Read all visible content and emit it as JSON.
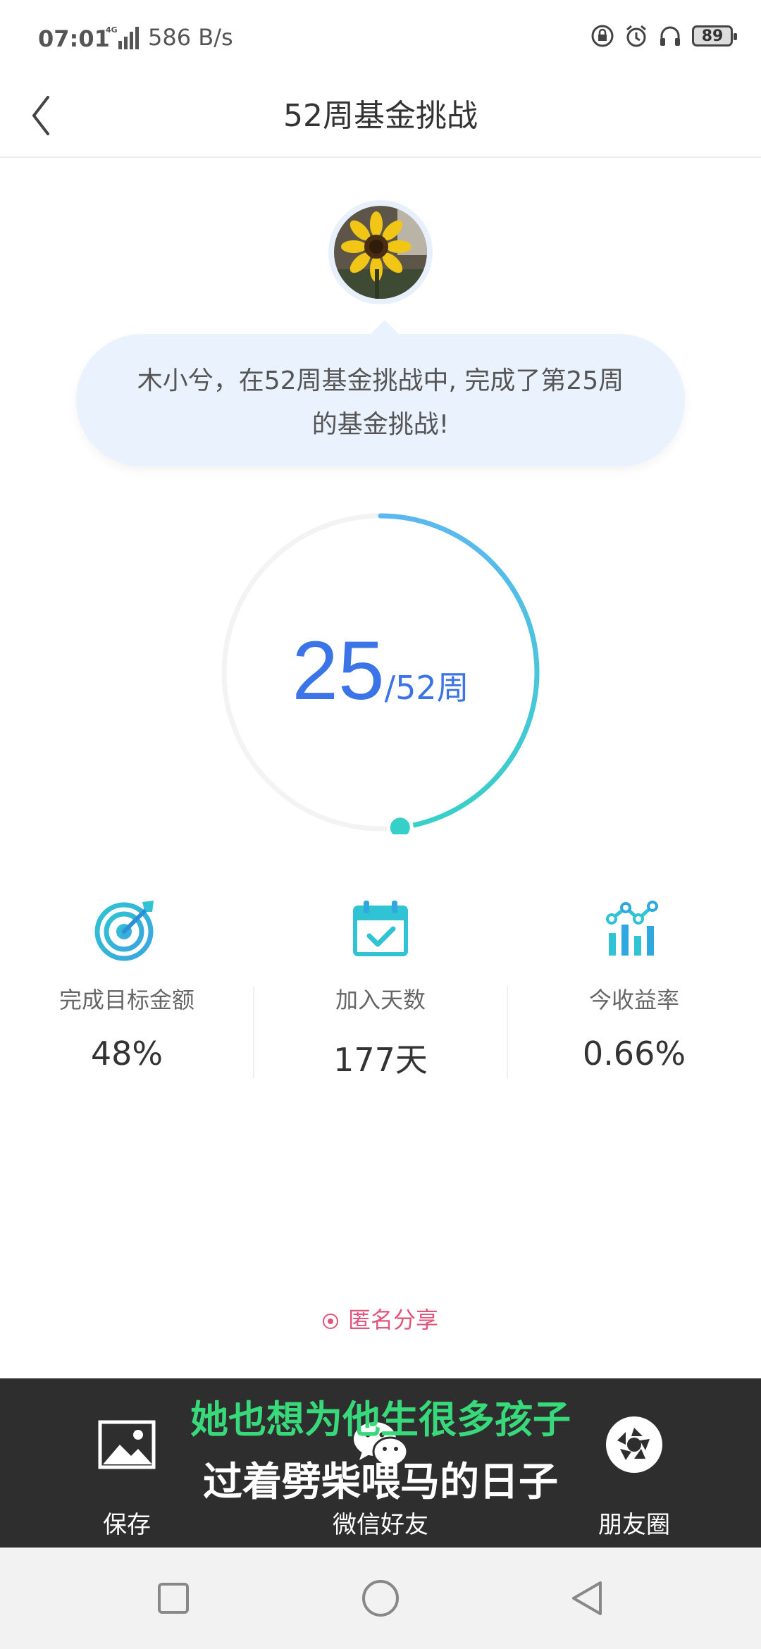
{
  "status_bar": {
    "time": "07:01",
    "network": "4G",
    "speed": "586 B/s",
    "battery": "89",
    "icons": [
      "lock-rotation-icon",
      "alarm-icon",
      "headphones-icon",
      "battery-icon"
    ]
  },
  "header": {
    "title": "52周基金挑战",
    "back_icon": "chevron-left-icon"
  },
  "bubble": {
    "line1": "木小兮，在52周基金挑战中, 完成了第25周",
    "line2": "的基金挑战!"
  },
  "progress": {
    "current": "25",
    "total_label": "/52周",
    "fraction": 0.48,
    "color_start": "#5bb8ef",
    "color_end": "#37d0c8"
  },
  "stats": [
    {
      "icon": "target-icon",
      "label": "完成目标金额",
      "value": "48%"
    },
    {
      "icon": "calendar-check-icon",
      "label": "加入天数",
      "value": "177天"
    },
    {
      "icon": "bar-chart-icon",
      "label": "今收益率",
      "value": "0.66%"
    }
  ],
  "anonymous_share": {
    "label": "匿名分享",
    "color": "#e0567a"
  },
  "share_bar": {
    "items": [
      {
        "icon": "image-icon",
        "label": "保存"
      },
      {
        "icon": "wechat-icon",
        "label": "微信好友"
      },
      {
        "icon": "aperture-icon",
        "label": "朋友圈"
      }
    ]
  },
  "subtitles": {
    "line1": "她也想为他生很多孩子",
    "line2": "过着劈柴喂马的日子"
  },
  "nav_bar": {
    "icons": [
      "recent-apps-icon",
      "home-icon",
      "back-icon"
    ]
  }
}
